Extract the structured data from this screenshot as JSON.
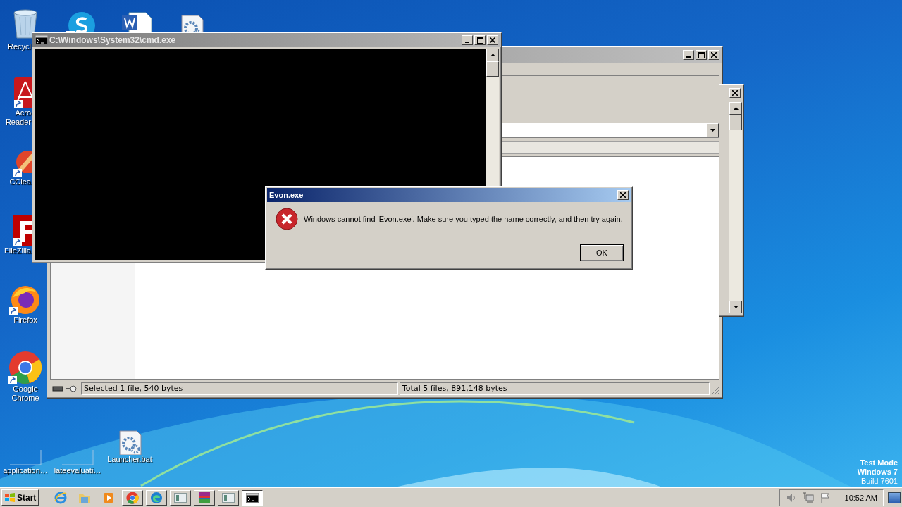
{
  "desktop_icons": [
    {
      "kind": "recycle-bin",
      "shortcut": false,
      "lines": [
        "Recycl"
      ]
    },
    {
      "kind": "skype",
      "shortcut": true
    },
    {
      "kind": "word-doc",
      "shortcut": false
    },
    {
      "kind": "settings-doc",
      "shortcut": false
    },
    {
      "kind": "acrobat",
      "shortcut": true,
      "lines": [
        "Acro",
        "Reader"
      ]
    },
    {
      "kind": "ccleaner",
      "shortcut": true,
      "lines": [
        "CClea"
      ]
    },
    {
      "kind": "filezilla",
      "shortcut": true,
      "lines": [
        "FileZilla"
      ]
    },
    {
      "kind": "firefox",
      "shortcut": true,
      "lines": [
        "Firefox"
      ]
    },
    {
      "kind": "chrome",
      "shortcut": true,
      "lines": [
        "Google",
        "Chrome"
      ]
    },
    {
      "kind": "blank",
      "shortcut": false,
      "lines": [
        "application…"
      ]
    },
    {
      "kind": "blank",
      "shortcut": false,
      "lines": [
        "lateevaluati…"
      ]
    },
    {
      "kind": "bat-file",
      "shortcut": false,
      "lines": [
        "Launcher.bat"
      ]
    }
  ],
  "explorer_window": {
    "status_left": "Selected 1 file, 540 bytes",
    "status_right": "Total 5 files, 891,148 bytes"
  },
  "cmd_window": {
    "title": "C:\\Windows\\System32\\cmd.exe"
  },
  "dialog": {
    "title": "Evon.exe",
    "message": "Windows cannot find 'Evon.exe'. Make sure you typed the name correctly, and then try again.",
    "button": "OK"
  },
  "watermark": [
    "Test Mode",
    "Windows 7",
    "Build 7601"
  ],
  "taskbar": {
    "start": "Start",
    "quick_launch": [
      {
        "kind": "ie"
      },
      {
        "kind": "folder"
      },
      {
        "kind": "media"
      }
    ],
    "buttons": [
      {
        "kind": "chrome",
        "selected": false
      },
      {
        "kind": "edge",
        "selected": false
      },
      {
        "kind": "window",
        "selected": false
      },
      {
        "kind": "winrar",
        "selected": false
      },
      {
        "kind": "window",
        "selected": false
      },
      {
        "kind": "cmd",
        "selected": true
      }
    ],
    "tray": [
      {
        "kind": "speaker"
      },
      {
        "kind": "network"
      },
      {
        "kind": "flag"
      }
    ],
    "clock": "10:52 AM"
  }
}
